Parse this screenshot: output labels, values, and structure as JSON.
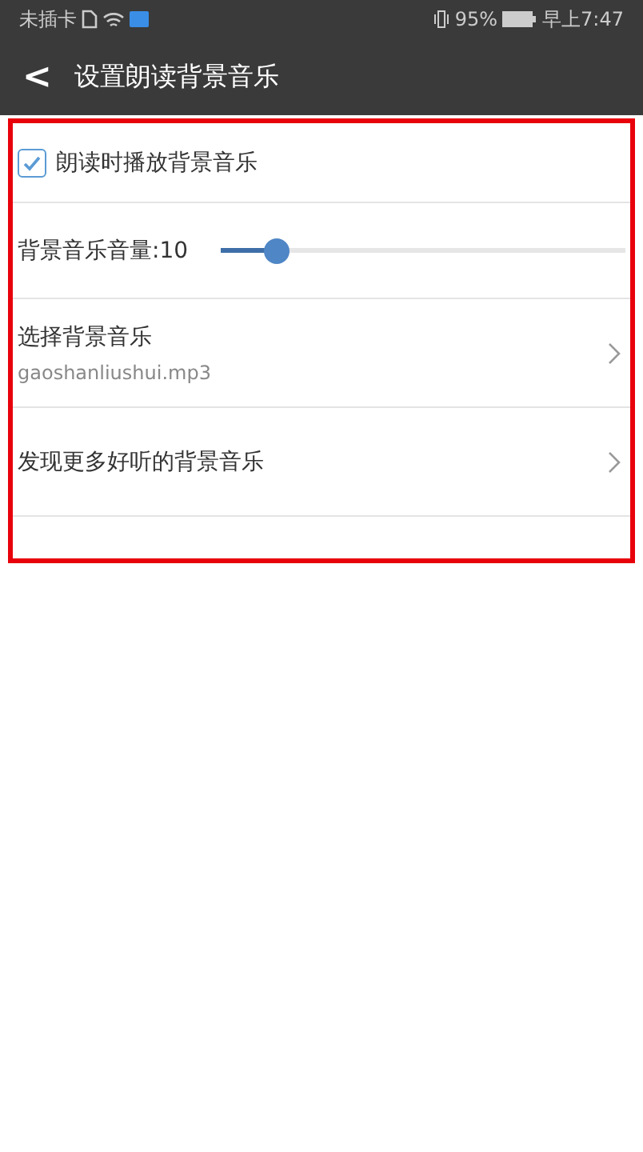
{
  "status_bar": {
    "carrier": "未插卡",
    "battery": "95%",
    "time": "早上7:47"
  },
  "header": {
    "back": "<",
    "title": "设置朗读背景音乐"
  },
  "settings": [
    {
      "kind": "checkbox",
      "label": "朗读时播放背景音乐",
      "checked": true
    },
    {
      "kind": "slider",
      "label": "背景音乐音量:10",
      "level": 0.14
    },
    {
      "kind": "link",
      "label": "选择背景音乐",
      "value": "gaoshanliushui.mp3"
    },
    {
      "kind": "link",
      "label": "发现更多好听的背景音乐"
    }
  ]
}
